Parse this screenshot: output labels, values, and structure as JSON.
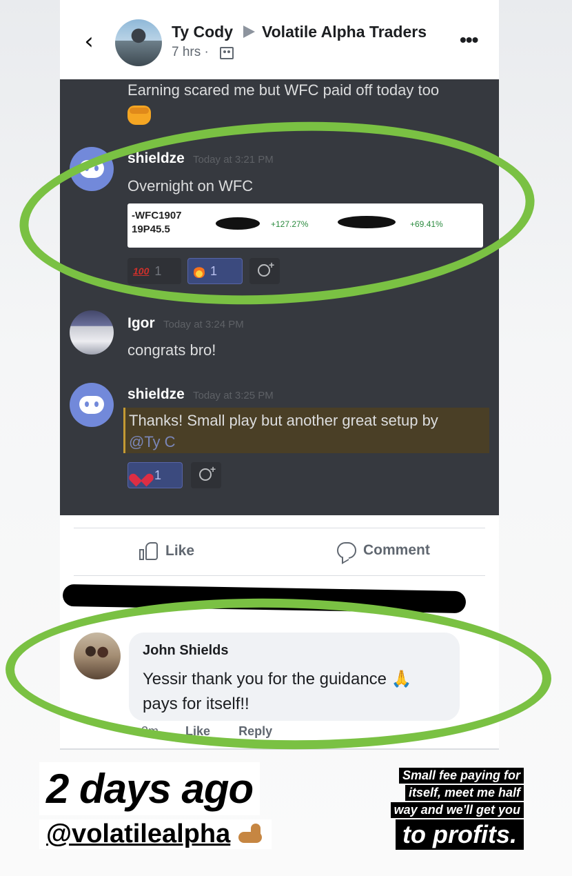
{
  "post": {
    "author": "Ty Cody",
    "group": "Volatile Alpha Traders",
    "time": "7 hrs ·",
    "more": "•••",
    "back": "‹"
  },
  "discord": {
    "prev_message": "Earning scared me but WFC paid off today too",
    "messages": [
      {
        "author": "shieldze",
        "timestamp": "Today at 3:21 PM",
        "text": "Overnight on WFC",
        "trade": {
          "ticker": "-WFC1907\n19P45.5",
          "pct1": "+127.27%",
          "pct2": "+69.41%"
        },
        "reactions": [
          {
            "emoji": "100",
            "count": "1"
          },
          {
            "emoji": "fire",
            "count": "1"
          }
        ]
      },
      {
        "author": "Igor",
        "timestamp": "Today at 3:24 PM",
        "text": "congrats  bro!"
      },
      {
        "author": "shieldze",
        "timestamp": "Today at 3:25 PM",
        "text_line1": "Thanks! Small play but another great setup by",
        "mention": "@Ty C",
        "reactions": [
          {
            "emoji": "heart",
            "count": "1"
          }
        ]
      }
    ]
  },
  "actions": {
    "like": "Like",
    "comment": "Comment"
  },
  "comment": {
    "author": "John Shields",
    "text": "Yessir thank you for the guidance 🙏 pays for itself!!",
    "time": "2m",
    "like": "Like",
    "reply": "Reply"
  },
  "overlay": {
    "headline": "2 days ago",
    "handle": "@volatilealpha",
    "caption_lines": [
      "Small fee paying for",
      "itself, meet me half",
      "way and we'll get you"
    ],
    "caption_big": "to profits."
  },
  "colors": {
    "highlight": "#7ac143",
    "discord_bg": "#36393f",
    "blurple": "#7289da"
  }
}
